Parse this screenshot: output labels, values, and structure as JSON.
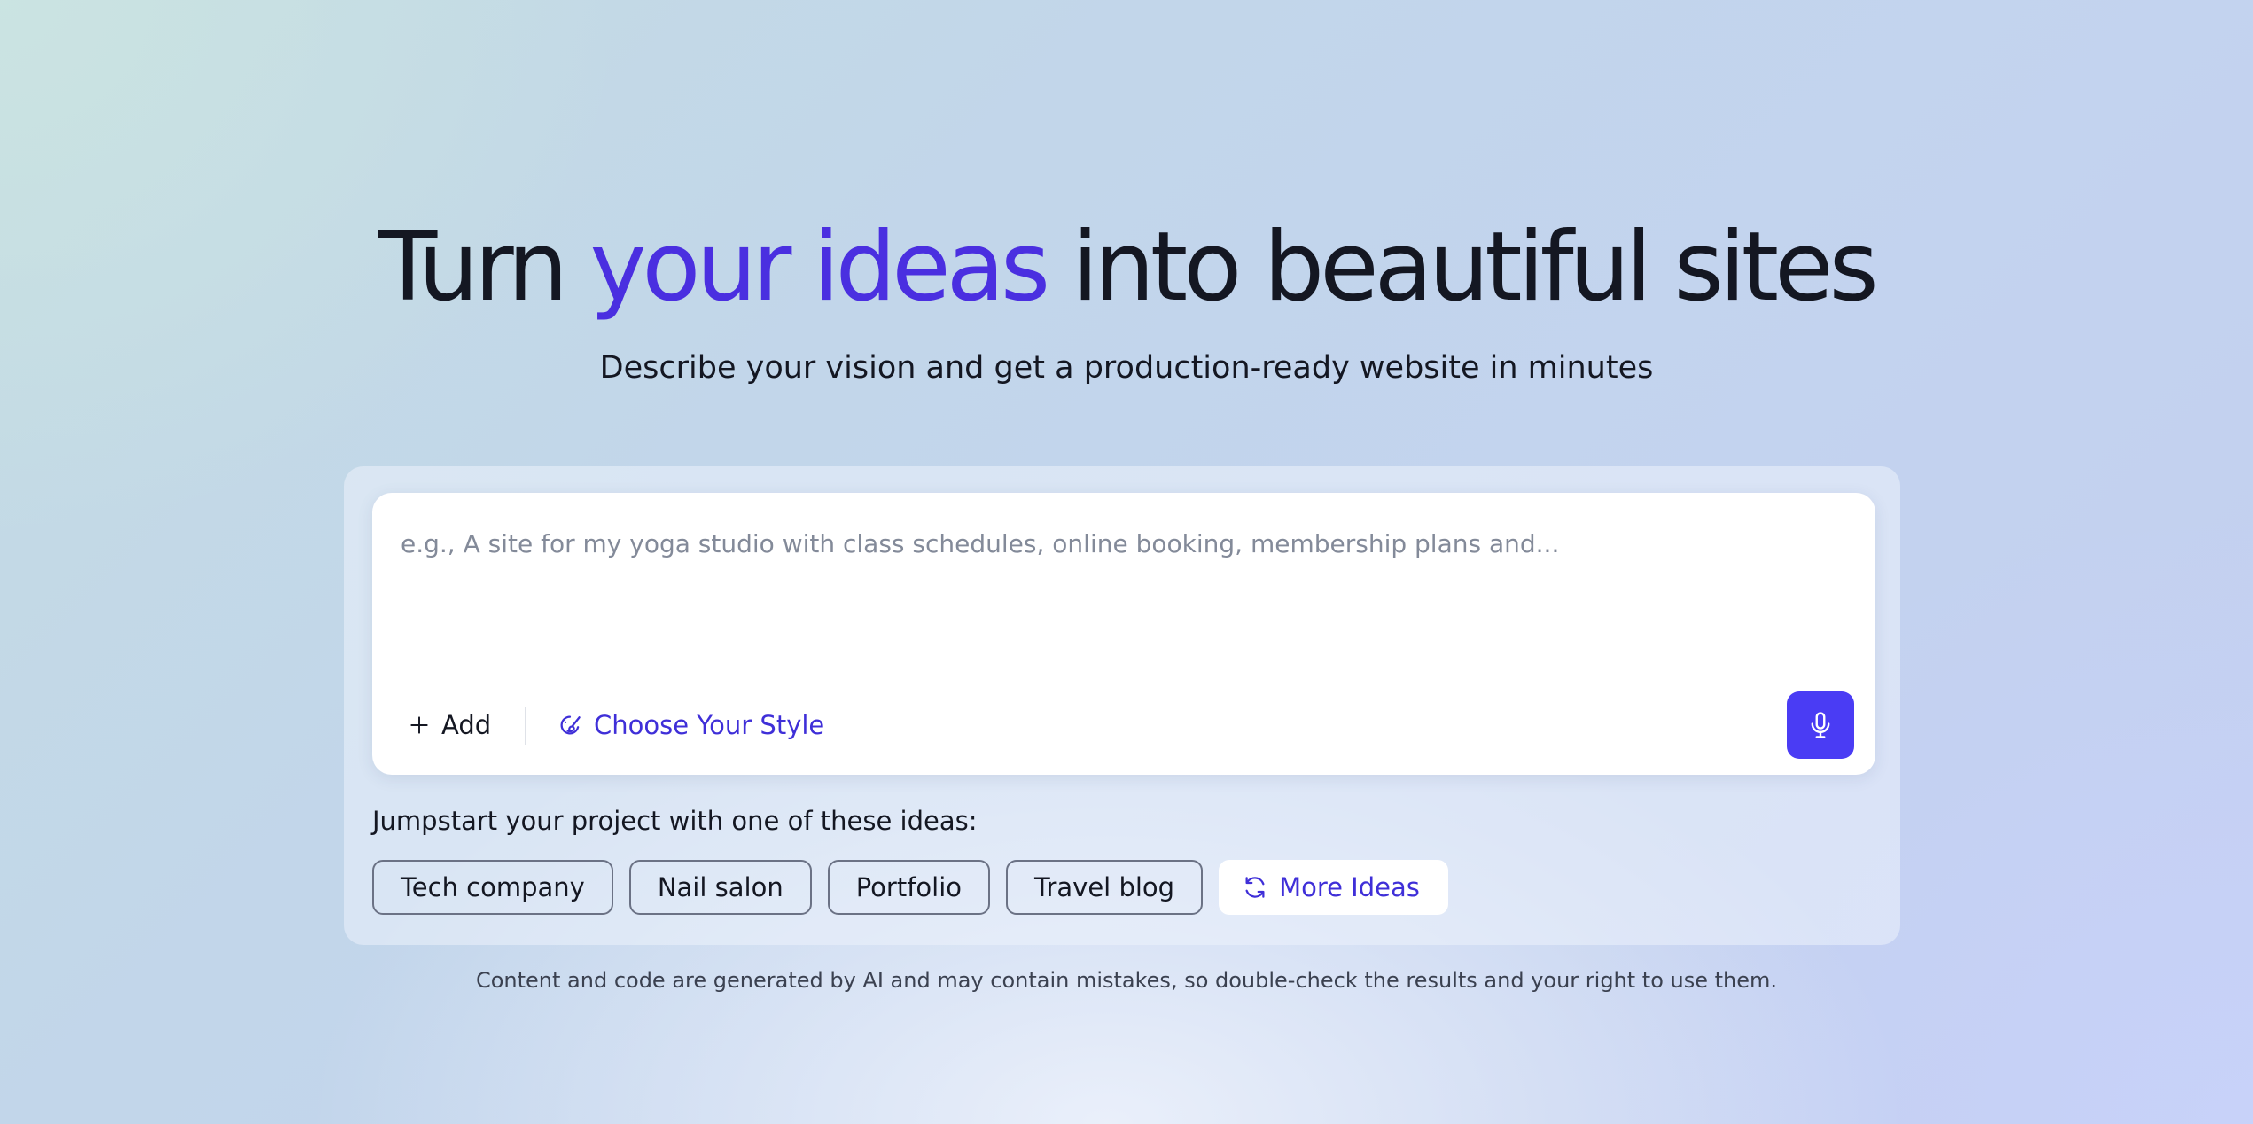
{
  "hero": {
    "title_start": "Turn ",
    "title_accent": "your ideas",
    "title_end": " into beautiful sites",
    "subtitle": "Describe your vision and get a production-ready website in minutes"
  },
  "prompt": {
    "value": "",
    "placeholder": "e.g., A site for my yoga studio with class schedules, online booking, membership plans and..."
  },
  "toolbar": {
    "add_label": "Add",
    "style_label": "Choose Your Style",
    "mic_icon": "microphone-icon"
  },
  "ideas": {
    "label": "Jumpstart your project with one of these ideas:",
    "chips": [
      "Tech company",
      "Nail salon",
      "Portfolio",
      "Travel blog"
    ],
    "more_label": "More Ideas"
  },
  "disclaimer": "Content and code are generated by AI and may contain mistakes, so double-check the results and your right to use them.",
  "colors": {
    "accent": "#4a2fe0",
    "link": "#3f2fd8",
    "mic_button": "#4a3cf4",
    "text": "#141722"
  }
}
